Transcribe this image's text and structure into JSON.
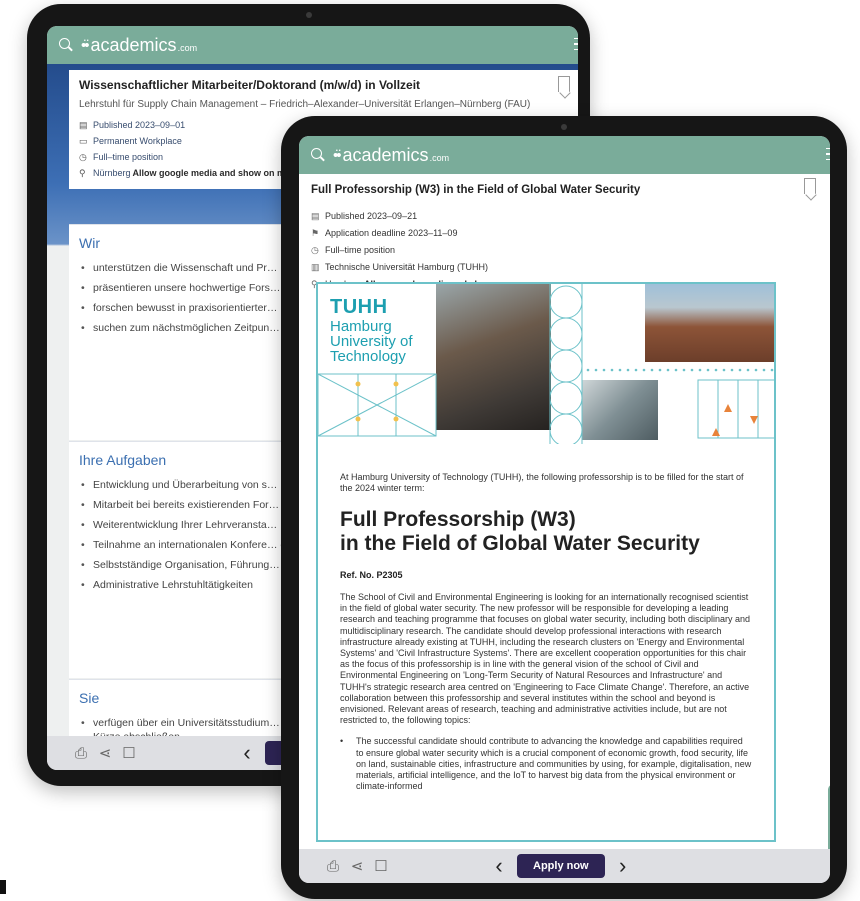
{
  "brand": {
    "name": "academics",
    "tld": ".com",
    "accent": "#7aac9a",
    "apply_color": "#2d2454"
  },
  "back": {
    "job_title": "Wissenschaftlicher Mitarbeiter/Doktorand (m/w/d) in Vollzeit",
    "employer": "Lehrstuhl für Supply Chain Management – Friedrich–Alexander–Universität Erlangen–Nürnberg (FAU)",
    "meta": {
      "published": "Published 2023–09–01",
      "workplace": "Permanent Workplace",
      "position": "Full–time position",
      "location": "Nürnberg",
      "map_link": "Allow google media and show on map"
    },
    "sections": [
      {
        "title": "Wir",
        "items": [
          "unterstützen die Wissenschaft und Pr… Forschungsbereichen Human Capital, … Zukunftsforschung",
          "präsentieren unsere hochwertige Fors… publizieren diese in exzellenten Fachm…",
          "forschen bewusst in praxisorientierter… Form von Projekten und Kooperatione…",
          "suchen zum nächstmöglichen Zeitpun… (TV–L E 13) in Vollzeit (100%)"
        ]
      },
      {
        "title": "Ihre Aufgaben",
        "items": [
          "Entwicklung und Überarbeitung von s… Forschungsanträgen im Forschungste…",
          "Mitarbeit bei bereits existierenden For…",
          "Weiterentwicklung Ihrer Lehrveransta…",
          "Teilnahme an internationalen Konfere… exzellenten Fachjournalen",
          "Selbstständige Organisation, Führung… Kooperationsprojekten mit Praxispart…",
          "Administrative Lehrstuhltätigkeiten"
        ]
      },
      {
        "title": "Sie",
        "items": [
          "verfügen über ein Universitätsstudium… Wirtschaftsingenieurwesen oder Wirt… werden dieses in Kürze abschließen"
        ]
      }
    ]
  },
  "front": {
    "job_title": "Full Professorship (W3) in the Field of Global Water Security",
    "meta": {
      "published": "Published 2023–09–21",
      "deadline": "Application deadline 2023–11–09",
      "position": "Full–time position",
      "institution": "Technische Universität Hamburg (TUHH)",
      "location": "Hamburg",
      "map_link": "Allow google media and show on map"
    },
    "logo": {
      "abbr": "TUHH",
      "line1": "Hamburg",
      "line2": "University of",
      "line3": "Technology"
    },
    "intro": "At Hamburg University of Technology (TUHH), the following professorship is to be filled for the start of the 2024 winter term:",
    "heading_line1": "Full Professorship (W3)",
    "heading_line2": "in the Field of Global Water Security",
    "ref": "Ref. No. P2305",
    "body": "The School of Civil and Environmental Engineering is looking for an internationally recognised scientist in the field of global water security. The new professor will be responsible for developing a leading research and teaching programme that focuses on global water security, including both disciplinary and multidisciplinary research. The candidate should develop professional interactions with research infrastructure already existing at TUHH, including the research clusters on 'Energy and Environmental Systems' and 'Civil Infrastructure Systems'. There are excellent cooperation opportunities for this chair as the focus of this professorship is in line with the general vision of the school of Civil and Environmental Engineering on 'Long-Term Security of Natural Resources and Infrastructure' and TUHH's strategic research area centred on 'Engineering to Face Climate Change'. Therefore, an active collaboration between this professorship and several institutes within the school and beyond is envisioned. Relevant areas of research, teaching and administrative activities include, but are not restricted to, the following topics:",
    "bullet": "The successful candidate should contribute to advancing the knowledge and capabilities required to ensure global water security which is a crucial component of economic growth, food security, life on land, sustainable cities, infrastructure and communities by using, for example, digitalisation, new materials, artificial intelligence, and the IoT to harvest big data from the physical environment or climate-informed"
  },
  "footer": {
    "apply_label": "Apply now",
    "prev_icon": "chevron-left-icon",
    "next_icon": "chevron-right-icon"
  }
}
